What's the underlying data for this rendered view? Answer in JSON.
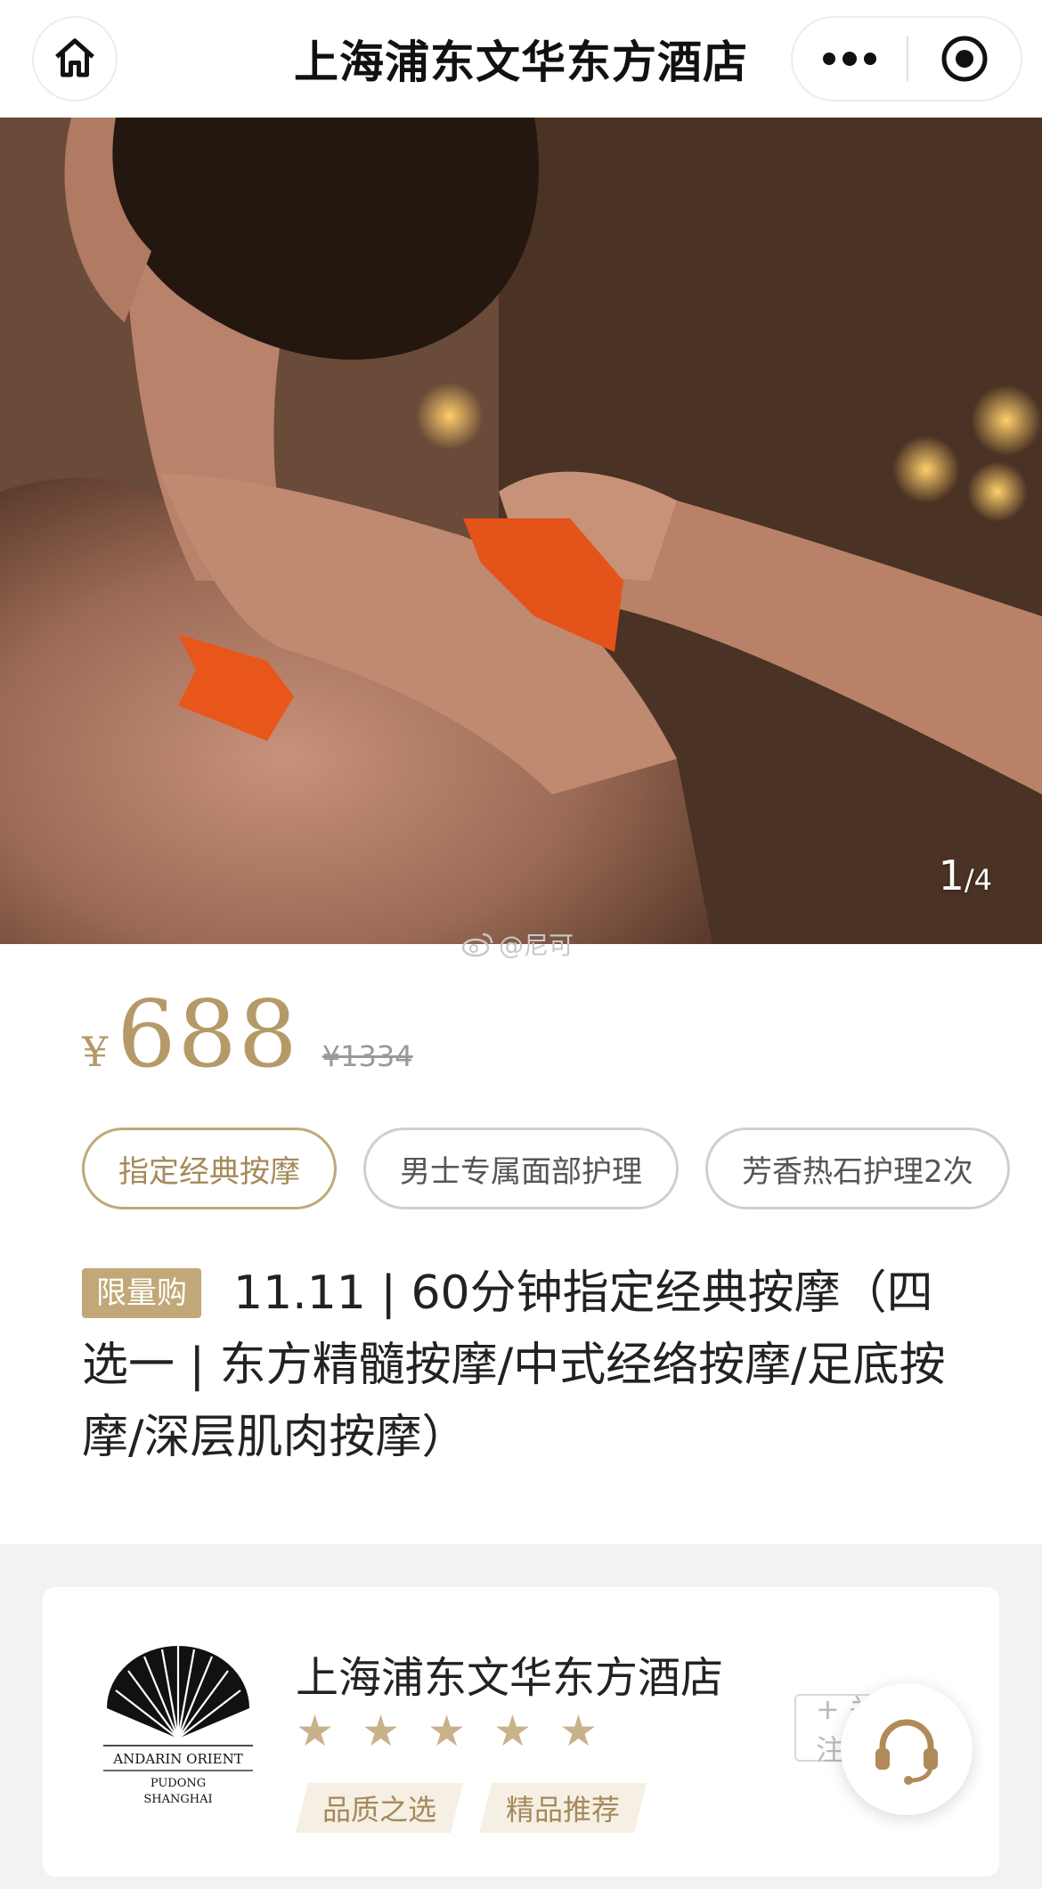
{
  "nav": {
    "title": "上海浦东文华东方酒店"
  },
  "gallery": {
    "current": "1",
    "total": "/4"
  },
  "watermark": "@尼可",
  "price": {
    "currency": "¥",
    "amount": "688",
    "original": "¥1334"
  },
  "options": [
    {
      "label": "指定经典按摩",
      "selected": true
    },
    {
      "label": "男士专属面部护理",
      "selected": false
    },
    {
      "label": "芳香热石护理2次",
      "selected": false
    }
  ],
  "product": {
    "badge": "限量购",
    "title": "11.11 | 60分钟指定经典按摩（四选一 | 东方精髓按摩/中式经络按摩/足底按摩/深层肌肉按摩）"
  },
  "shop": {
    "name": "上海浦东文华东方酒店",
    "rating_stars": 5,
    "logo_text": [
      "ANDARIN ORIENT",
      "PUDONG",
      "SHANGHAI"
    ],
    "tags": [
      "品质之选",
      "精品推荐"
    ],
    "follow_label": "+ 关注"
  },
  "colors": {
    "accent_gold": "#b59a68",
    "badge_bg": "#c2a878",
    "tag_bg": "#f6efe3"
  },
  "icons": [
    "home-icon",
    "more-icon",
    "close-icon",
    "weibo-icon",
    "star-icon",
    "headset-icon"
  ]
}
